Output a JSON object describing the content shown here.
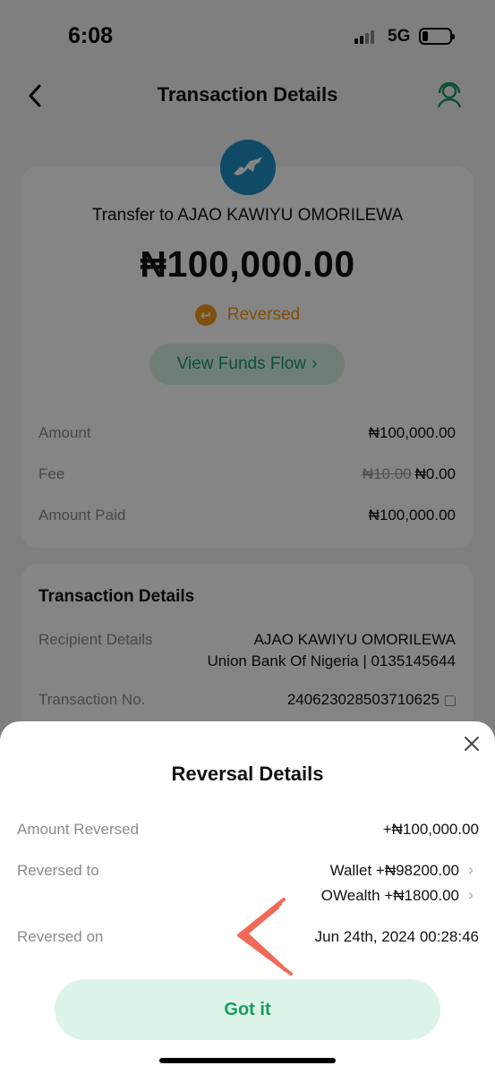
{
  "status_bar": {
    "time": "6:08",
    "network": "5G"
  },
  "header": {
    "title": "Transaction Details"
  },
  "summary": {
    "transfer_to": "Transfer to AJAO KAWIYU OMORILEWA",
    "amount": "₦100,000.00",
    "status": "Reversed",
    "funds_flow_label": "View Funds Flow",
    "rows": {
      "amount_label": "Amount",
      "amount_value": "₦100,000.00",
      "fee_label": "Fee",
      "fee_original": "₦10.00",
      "fee_value": "₦0.00",
      "paid_label": "Amount Paid",
      "paid_value": "₦100,000.00"
    }
  },
  "details": {
    "title": "Transaction Details",
    "recipient_label": "Recipient Details",
    "recipient_name": "AJAO KAWIYU OMORILEWA",
    "recipient_bank": "Union Bank Of Nigeria | 0135145644",
    "txn_label": "Transaction No.",
    "txn_value": "240623028503710625"
  },
  "sheet": {
    "title": "Reversal Details",
    "amount_label": "Amount Reversed",
    "amount_value": "+₦100,000.00",
    "reversed_to_label": "Reversed to",
    "wallet": "Wallet +₦98200.00",
    "owealth": "OWealth +₦1800.00",
    "reversed_on_label": "Reversed on",
    "reversed_on_value": "Jun 24th, 2024 00:28:46",
    "button": "Got it"
  },
  "colors": {
    "accent": "#1a9a5e",
    "warning": "#f09a1b",
    "brand_logo": "#1d8fc4"
  },
  "icons": [
    "back-arrow-icon",
    "support-headset-icon",
    "horse-logo-icon",
    "reversed-status-icon",
    "chevron-right-icon",
    "copy-icon",
    "close-icon"
  ]
}
